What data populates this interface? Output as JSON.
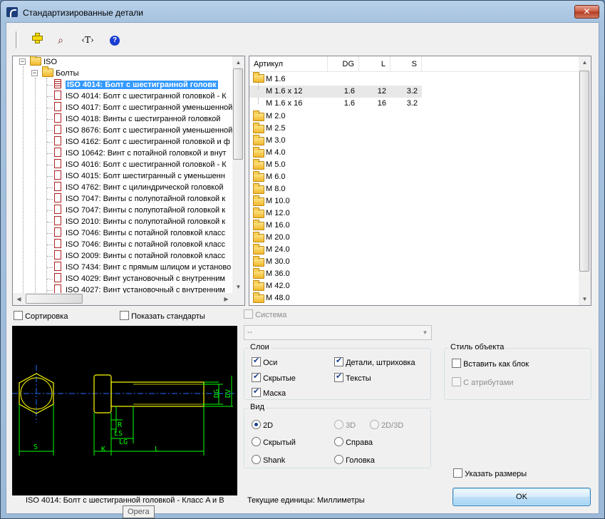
{
  "window": {
    "title": "Стандартизированные детали",
    "close_label": "✕"
  },
  "toolbar": {
    "text_label": "‹T›",
    "help_label": "?"
  },
  "tree": {
    "root": "ISO",
    "folder": "Болты",
    "items": [
      "ISO 4014: Болт с шестигранной головк",
      "ISO 4014: Болт с шестигранной головкой - К",
      "ISO 4017: Болт с шестигранной уменьшенной",
      "ISO 4018: Винты с шестигранной головкой",
      "ISO 8676: Болт с шестигранной уменьшенной",
      "ISO 4162: Болт с шестигранной головкой и ф",
      "ISO 10642: Винт с потайной головкой и внут",
      "ISO 4016: Болт с шестигранной головкой - К",
      "ISO 4015: Болт шестигранный с уменьшенн",
      "ISO 4762: Винт с цилиндрической головкой",
      "ISO 7047: Винты с полупотайной головкой к",
      "ISO 7047: Винты с полупотайной головкой к",
      "ISO 2010: Винты с полупотайной головкой к",
      "ISO 7046: Винты с потайной головкой класс",
      "ISO 7046: Винты с потайной головкой класс",
      "ISO 2009: Винты с потайной головкой класс",
      "ISO 7434: Винт с прямым шлицом и установо",
      "ISO 4029: Винт установочный с внутренним",
      "ISO 4027: Винт установочный с внутренним"
    ]
  },
  "grid": {
    "columns": [
      "Артикул",
      "DG",
      "L",
      "S"
    ],
    "open_folder": "M 1.6",
    "rows": [
      {
        "name": "M 1.6 x 12",
        "dg": "1.6",
        "l": "12",
        "s": "3.2"
      },
      {
        "name": "M 1.6 x 16",
        "dg": "1.6",
        "l": "16",
        "s": "3.2"
      }
    ],
    "folders": [
      "M 2.0",
      "M 2.5",
      "M 3.0",
      "M 4.0",
      "M 5.0",
      "M 6.0",
      "M 8.0",
      "M 10.0",
      "M 12.0",
      "M 16.0",
      "M 20.0",
      "M 24.0",
      "M 30.0",
      "M 36.0",
      "M 42.0",
      "M 48.0"
    ]
  },
  "options": {
    "sort_label": "Сортировка",
    "show_standards_label": "Показать стандарты",
    "system_label": "Система",
    "combo_value": "--"
  },
  "layers": {
    "title": "Слои",
    "axes": "Оси",
    "details": "Детали, штриховка",
    "hidden": "Скрытые",
    "texts": "Тексты",
    "mask": "Маска"
  },
  "view": {
    "title": "Вид",
    "v2d": "2D",
    "v3d": "3D",
    "v2d3d": "2D/3D",
    "hidden": "Скрытый",
    "right": "Справа",
    "shank": "Shank",
    "head": "Головка"
  },
  "style": {
    "title": "Стиль объекта",
    "insert_block": "Вставить как блок",
    "with_attrs": "С атрибутами"
  },
  "preview": {
    "dims": {
      "dg": "DG",
      "dv": "DV",
      "r": "R",
      "ls": "LS",
      "lg": "LG",
      "l": "L",
      "k": "K",
      "s": "S"
    }
  },
  "footer": {
    "caption": "ISO 4014: Болт с шестигранной головкой - Класс A и B",
    "units": "Текущие единицы: Миллиметры",
    "specify_sizes": "Указать размеры",
    "ok_label": "OK",
    "tooltip": "Opera"
  },
  "colors": {
    "selection": "#3399ff",
    "drawing_green": "#00ff00",
    "drawing_yellow": "#ffff00",
    "axis_blue": "#1e6bff"
  }
}
